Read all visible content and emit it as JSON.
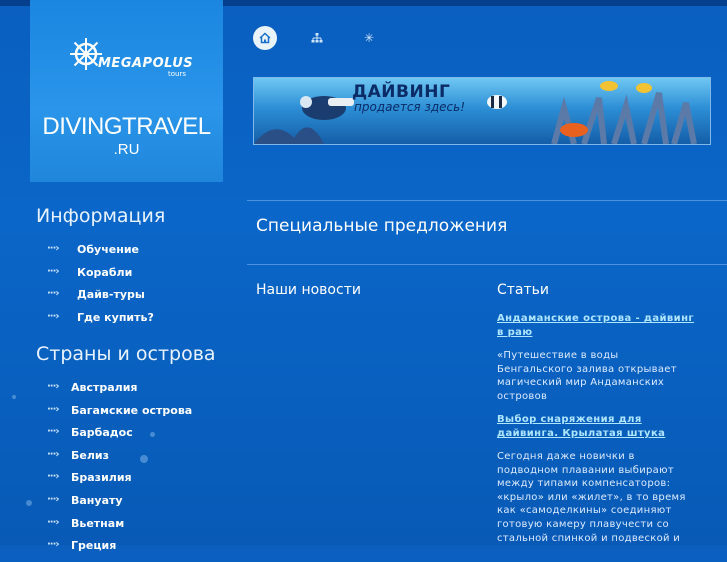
{
  "header": {
    "brand_name": "MEGAPOLUS",
    "brand_sub": "tours",
    "site_name": "DIVINGTRAVEL",
    "site_tld": ".RU"
  },
  "toplinks": {
    "icons": [
      "home-icon",
      "sitemap-icon",
      "snowflake-icon"
    ]
  },
  "banner": {
    "title": "ДАЙВИНГ",
    "subtitle": "продается здесь!"
  },
  "sidebar": {
    "info_title": "Информация",
    "info_items": [
      {
        "label": "Обучение"
      },
      {
        "label": "Корабли"
      },
      {
        "label": "Дайв-туры"
      },
      {
        "label": "Где купить?"
      }
    ],
    "countries_title": "Страны и острова",
    "country_items": [
      {
        "label": "Австралия"
      },
      {
        "label": "Багамские острова"
      },
      {
        "label": "Барбадос"
      },
      {
        "label": "Белиз"
      },
      {
        "label": "Бразилия"
      },
      {
        "label": "Вануату"
      },
      {
        "label": "Вьетнам"
      },
      {
        "label": "Греция"
      }
    ]
  },
  "main": {
    "special_title": "Специальные предложения",
    "news_title": "Наши новости",
    "articles_title": "Статьи",
    "articles": [
      {
        "link": "Андаманские острова - дайвинг в раю",
        "text": "«Путешествие в воды Бенгальского залива открывает магический мир Андаманских островов"
      },
      {
        "link": "Выбор снаряжения для дайвинга. Крылатая штука",
        "text": "Сегодня даже новички в подводном плавании выбирают между типами компенсаторов: «крыло» или «жилет», в то время как «самоделкины» соединяют готовую камеру плавучести со стальной спинкой и подвеской и"
      }
    ]
  },
  "colors": {
    "background": "#0a5fbf",
    "logo_panel": "#1b86e0",
    "link": "#aee6ff"
  }
}
